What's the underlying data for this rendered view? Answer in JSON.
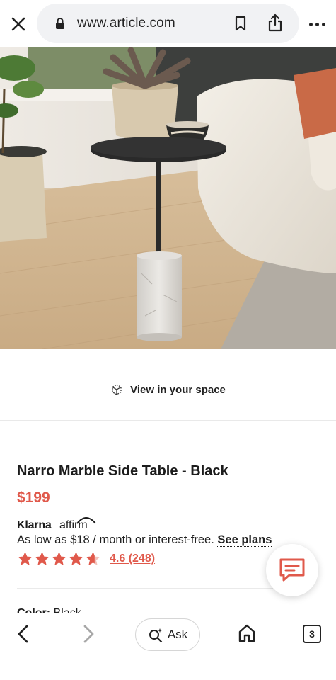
{
  "browser": {
    "url": "www.article.com",
    "tab_count": "3",
    "ask_label": "Ask"
  },
  "product": {
    "view_in_space_label": "View in your space",
    "title": "Narro Marble Side Table - Black",
    "price": "$199",
    "financing": {
      "klarna_logo": "Klarna",
      "affirm_logo": "affirm",
      "text": "As low as $18 / month or interest-free.",
      "link": "See plans"
    },
    "rating": {
      "stars": 4.6,
      "text": "4.6 (248)"
    },
    "color": {
      "label": "Color:",
      "value": "Black"
    }
  },
  "icons": {
    "close": "close-icon",
    "lock": "lock-icon",
    "bookmark": "bookmark-icon",
    "share": "share-icon",
    "more": "more-icon",
    "ar": "ar-cube-icon",
    "chat": "chat-icon",
    "back": "chevron-left-icon",
    "forward": "chevron-right-icon",
    "ask": "sparkle-search-icon",
    "home": "home-icon"
  },
  "colors": {
    "accent": "#e0594b",
    "text": "#1f1f1f"
  }
}
